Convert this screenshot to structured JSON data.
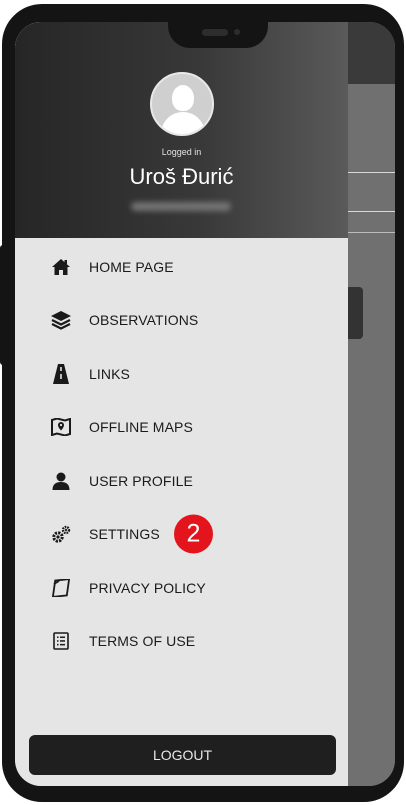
{
  "header": {
    "status": "Logged in",
    "username": "Uroš Đurić"
  },
  "menu": [
    {
      "label": "HOME PAGE",
      "icon": "home-icon"
    },
    {
      "label": "OBSERVATIONS",
      "icon": "layers-icon"
    },
    {
      "label": "LINKS",
      "icon": "road-icon"
    },
    {
      "label": "OFFLINE MAPS",
      "icon": "map-icon"
    },
    {
      "label": "USER PROFILE",
      "icon": "user-icon"
    },
    {
      "label": "SETTINGS",
      "icon": "gears-icon",
      "badge": "2"
    },
    {
      "label": "PRIVACY POLICY",
      "icon": "policy-icon"
    },
    {
      "label": "TERMS OF USE",
      "icon": "document-icon"
    }
  ],
  "logout_label": "LOGOUT",
  "colors": {
    "badge": "#e3141b",
    "header_dark": "#262626",
    "drawer_bg": "#e5e5e5"
  }
}
